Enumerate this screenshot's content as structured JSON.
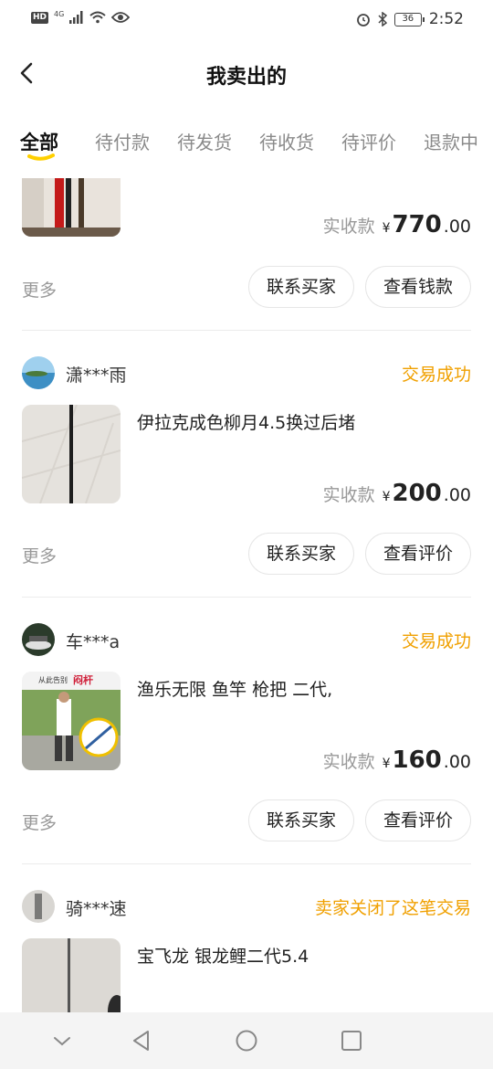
{
  "statusbar": {
    "network": "HD",
    "signal_type": "4G",
    "battery": "36",
    "time": "2:52"
  },
  "header": {
    "title": "我卖出的"
  },
  "tabs": [
    {
      "label": "全部",
      "active": true
    },
    {
      "label": "待付款"
    },
    {
      "label": "待发货"
    },
    {
      "label": "待收货"
    },
    {
      "label": "待评价"
    },
    {
      "label": "退款中"
    }
  ],
  "orders": [
    {
      "price_label": "实收款",
      "currency": "¥",
      "price_int": "770",
      "price_dec": ".00",
      "more": "更多",
      "btn_contact": "联系买家",
      "btn_action": "查看钱款"
    },
    {
      "buyer": "潇***雨",
      "status": "交易成功",
      "title": "伊拉克成色柳月4.5换过后堵",
      "price_label": "实收款",
      "currency": "¥",
      "price_int": "200",
      "price_dec": ".00",
      "more": "更多",
      "btn_contact": "联系买家",
      "btn_action": "查看评价"
    },
    {
      "buyer": "车***a",
      "status": "交易成功",
      "title": "渔乐无限 鱼竿 枪把 二代,",
      "thumb_text": "从此告别",
      "thumb_brand": "闷杆",
      "price_label": "实收款",
      "currency": "¥",
      "price_int": "160",
      "price_dec": ".00",
      "more": "更多",
      "btn_contact": "联系买家",
      "btn_action": "查看评价"
    },
    {
      "buyer": "骑***速",
      "status": "卖家关闭了这笔交易",
      "title": "宝飞龙 银龙鲤二代5.4"
    }
  ],
  "colors": {
    "accent": "#f0a000",
    "tab_underline": "#ffd000",
    "muted": "#999999"
  },
  "icons": [
    "back-arrow-icon",
    "alarm-icon",
    "bluetooth-icon",
    "wifi-icon",
    "eye-icon",
    "nav-down-icon",
    "nav-back-icon",
    "nav-home-icon",
    "nav-recents-icon"
  ]
}
